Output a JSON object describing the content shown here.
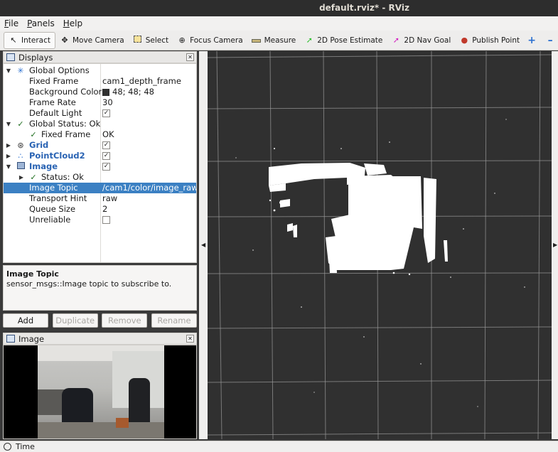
{
  "window": {
    "title": "default.rviz* - RViz"
  },
  "menu": {
    "items": [
      {
        "label": "File",
        "mnemonic": "F",
        "rest": "ile"
      },
      {
        "label": "Panels",
        "mnemonic": "P",
        "rest": "anels"
      },
      {
        "label": "Help",
        "mnemonic": "H",
        "rest": "elp"
      }
    ]
  },
  "toolbar": {
    "interact": "Interact",
    "move_camera": "Move Camera",
    "select": "Select",
    "focus_camera": "Focus Camera",
    "measure": "Measure",
    "pose_estimate": "2D Pose Estimate",
    "nav_goal": "2D Nav Goal",
    "publish_point": "Publish Point"
  },
  "displays": {
    "title": "Displays",
    "rows": [
      {
        "name": "Global Options",
        "value": ""
      },
      {
        "name": "Fixed Frame",
        "value": "cam1_depth_frame"
      },
      {
        "name": "Background Color",
        "value": "48; 48; 48"
      },
      {
        "name": "Frame Rate",
        "value": "30"
      },
      {
        "name": "Default Light",
        "value": "checked"
      },
      {
        "name": "Global Status: Ok",
        "value": ""
      },
      {
        "name": "Fixed Frame",
        "value": "OK"
      },
      {
        "name": "Grid",
        "value": "checked"
      },
      {
        "name": "PointCloud2",
        "value": "checked"
      },
      {
        "name": "Image",
        "value": "checked"
      },
      {
        "name": "Status: Ok",
        "value": ""
      },
      {
        "name": "Image Topic",
        "value": "/cam1/color/image_raw"
      },
      {
        "name": "Transport Hint",
        "value": "raw"
      },
      {
        "name": "Queue Size",
        "value": "2"
      },
      {
        "name": "Unreliable",
        "value": "unchecked"
      }
    ]
  },
  "description": {
    "title": "Image Topic",
    "text": "sensor_msgs::Image topic to subscribe to."
  },
  "buttons": {
    "add": "Add",
    "duplicate": "Duplicate",
    "remove": "Remove",
    "rename": "Rename"
  },
  "image_panel": {
    "title": "Image"
  },
  "status_bar": {
    "label": "Time"
  },
  "colors": {
    "background": "#303030",
    "selection": "#3b80c3",
    "accent": "#2963b3"
  }
}
